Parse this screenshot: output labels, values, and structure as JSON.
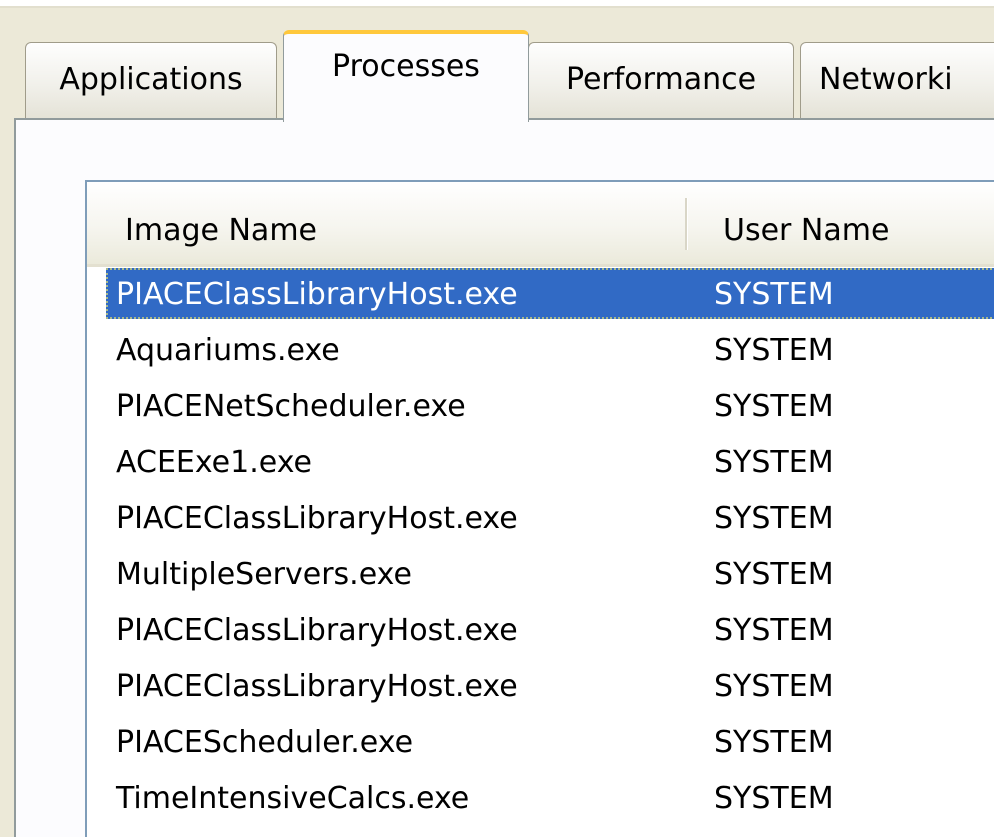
{
  "tabs": [
    {
      "label": "Applications",
      "active": false
    },
    {
      "label": "Processes",
      "active": true
    },
    {
      "label": "Performance",
      "active": false
    },
    {
      "label": "Networki",
      "active": false
    }
  ],
  "table": {
    "columns": [
      "Image Name",
      "User Name"
    ],
    "rows": [
      {
        "image_name": "PIACEClassLibraryHost.exe",
        "user_name": "SYSTEM",
        "selected": true
      },
      {
        "image_name": "Aquariums.exe",
        "user_name": "SYSTEM",
        "selected": false
      },
      {
        "image_name": "PIACENetScheduler.exe",
        "user_name": "SYSTEM",
        "selected": false
      },
      {
        "image_name": "ACEExe1.exe",
        "user_name": "SYSTEM",
        "selected": false
      },
      {
        "image_name": "PIACEClassLibraryHost.exe",
        "user_name": "SYSTEM",
        "selected": false
      },
      {
        "image_name": "MultipleServers.exe",
        "user_name": "SYSTEM",
        "selected": false
      },
      {
        "image_name": "PIACEClassLibraryHost.exe",
        "user_name": "SYSTEM",
        "selected": false
      },
      {
        "image_name": "PIACEClassLibraryHost.exe",
        "user_name": "SYSTEM",
        "selected": false
      },
      {
        "image_name": "PIACEScheduler.exe",
        "user_name": "SYSTEM",
        "selected": false
      },
      {
        "image_name": "TimeIntensiveCalcs.exe",
        "user_name": "SYSTEM",
        "selected": false
      }
    ]
  },
  "colors": {
    "selection": "#316ac5",
    "active_tab_accent": "#ffc83c",
    "window_background": "#ece9d8"
  }
}
